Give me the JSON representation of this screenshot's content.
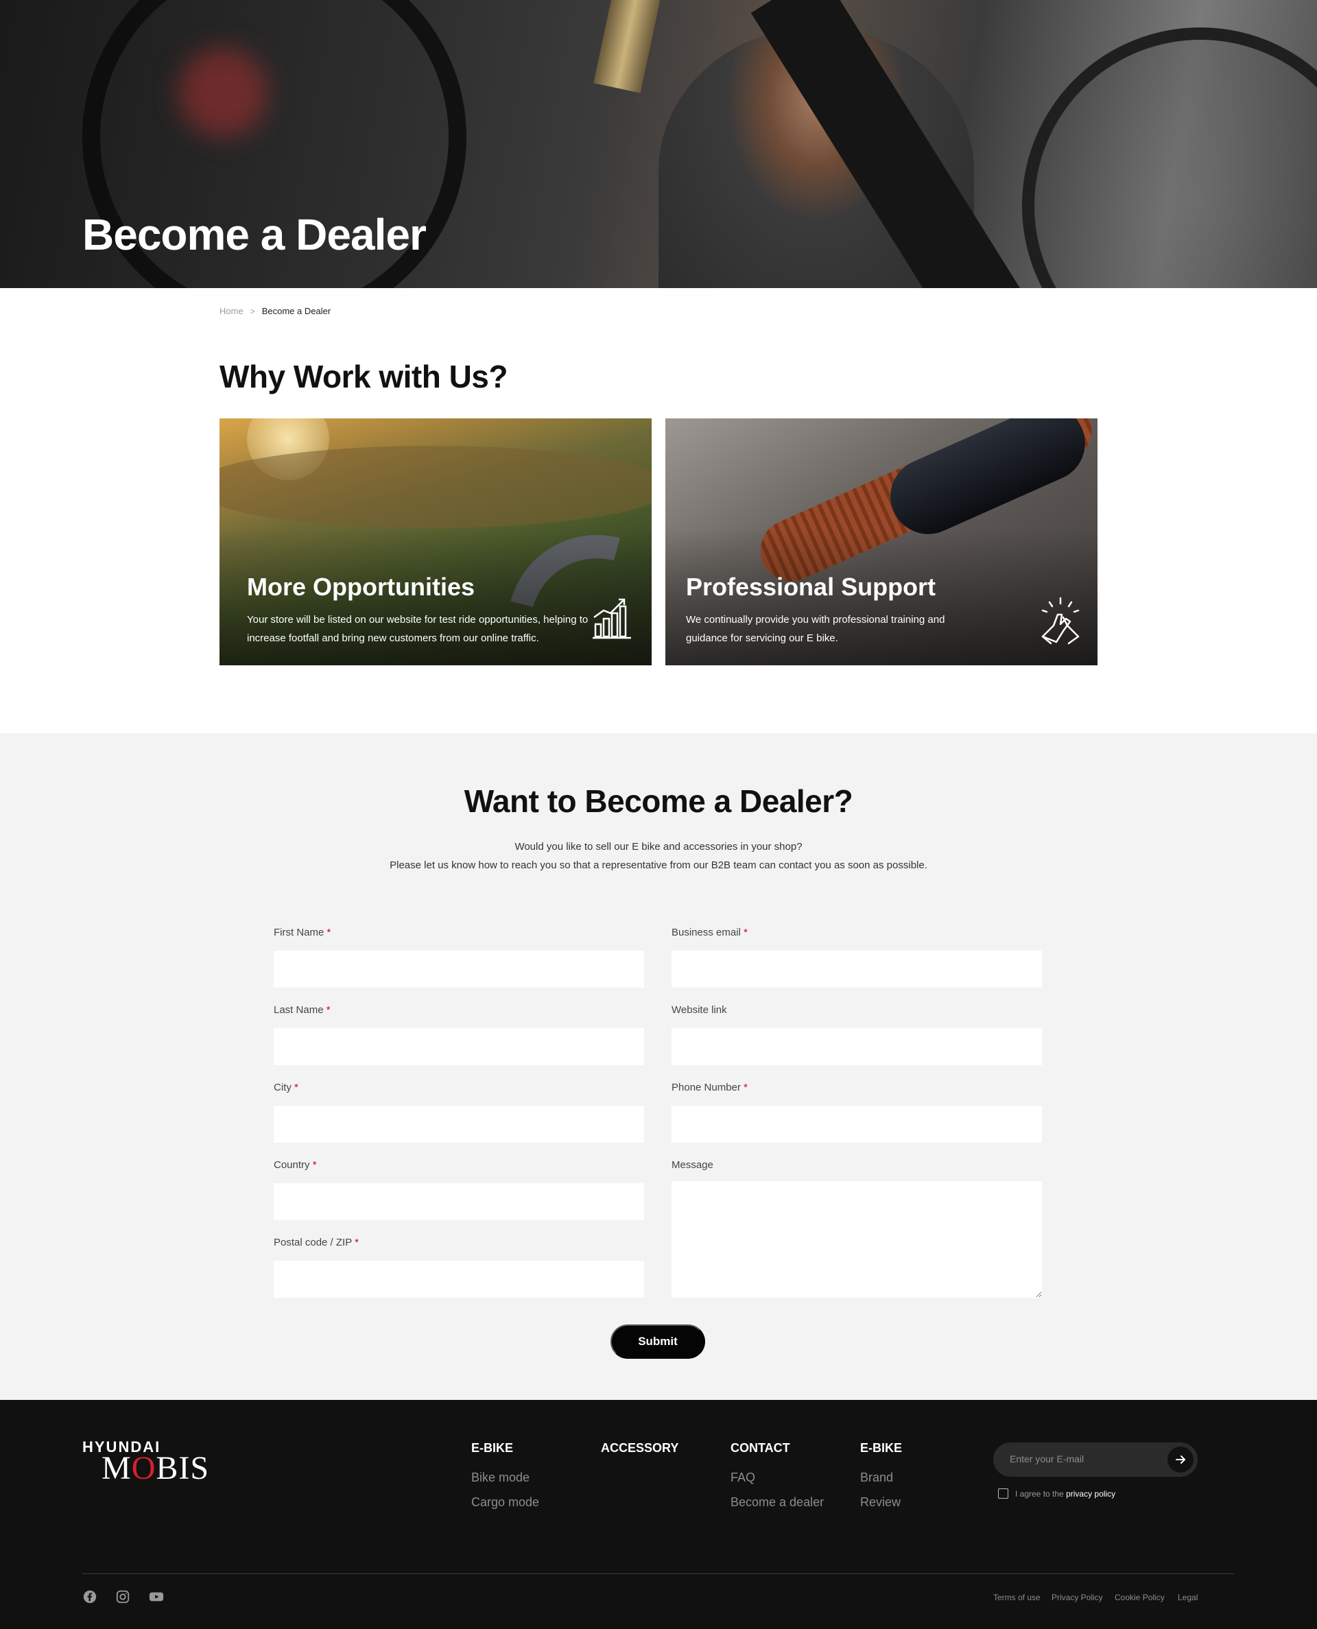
{
  "hero": {
    "title": "Become a Dealer"
  },
  "breadcrumb": {
    "home": "Home",
    "separator": ">",
    "current": "Become a Dealer"
  },
  "why": {
    "title": "Why Work with Us?",
    "cards": [
      {
        "title": "More Opportunities",
        "text": "Your store will be listed on our website for test ride opportunities, helping to increase footfall and bring new customers from our online traffic.",
        "icon": "bar-chart-icon"
      },
      {
        "title": "Professional Support",
        "text": "We continually provide you with professional training and guidance for servicing our E bike.",
        "icon": "handshake-icon"
      }
    ]
  },
  "form": {
    "title": "Want to Become a Dealer?",
    "subtitle_line1": "Would you like to sell our E bike and accessories in your shop?",
    "subtitle_line2": "Please let us know how to reach you so that a representative from our B2B team can contact you as soon as possible.",
    "fields": {
      "first_name": {
        "label": "First Name",
        "required": "*",
        "value": ""
      },
      "business_email": {
        "label": "Business email",
        "required": "*",
        "value": ""
      },
      "last_name": {
        "label": "Last Name",
        "required": "*",
        "value": ""
      },
      "website_link": {
        "label": "Website link",
        "required": "",
        "value": ""
      },
      "city": {
        "label": "City",
        "required": "*",
        "value": ""
      },
      "phone_number": {
        "label": "Phone Number",
        "required": "*",
        "value": ""
      },
      "country": {
        "label": "Country",
        "required": "*",
        "value": ""
      },
      "message": {
        "label": "Message",
        "required": "",
        "value": ""
      },
      "postal_code": {
        "label": "Postal code / ZIP",
        "required": "*",
        "value": ""
      }
    },
    "submit_label": "Submit"
  },
  "footer": {
    "logo_top": "HYUNDAI",
    "logo_main_m": "M",
    "logo_main_o": "O",
    "logo_main_rest": "BIS",
    "columns": [
      {
        "heading": "E-BIKE",
        "links": [
          "Bike mode",
          "Cargo mode"
        ]
      },
      {
        "heading": "ACCESSORY",
        "links": []
      },
      {
        "heading": "CONTACT",
        "links": [
          "FAQ",
          "Become a dealer"
        ]
      },
      {
        "heading": "E-BIKE",
        "links": [
          "Brand",
          "Review"
        ]
      }
    ],
    "newsletter": {
      "placeholder": "Enter your E-mail",
      "agree_prefix": "I agree to the",
      "agree_link": "privacy policy"
    },
    "social": [
      "facebook-icon",
      "instagram-icon",
      "youtube-icon"
    ],
    "legal_links": [
      "Terms of use",
      "Privacy Policy",
      "Cookie Policy",
      "Legal"
    ]
  },
  "colors": {
    "accent_red": "#d0021b",
    "footer_bg": "#111111",
    "form_bg": "#f3f3f3"
  }
}
